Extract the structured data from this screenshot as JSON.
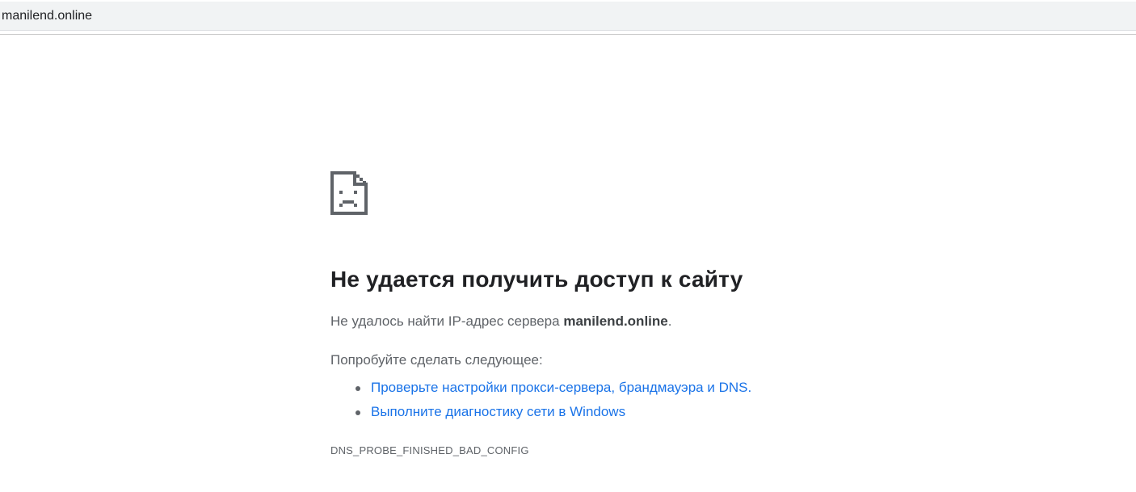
{
  "address_bar": {
    "url": "manilend.online"
  },
  "error": {
    "icon": "sad-page-icon",
    "title": "Не удается получить доступ к сайту",
    "subtitle_prefix": "Не удалось найти IP-адрес сервера ",
    "subtitle_host": "manilend.online",
    "subtitle_suffix": ".",
    "try_label": "Попробуйте сделать следующее:",
    "suggestions": [
      {
        "label": "Проверьте настройки прокси-сервера, брандмауэра и DNS."
      },
      {
        "label": "Выполните диагностику сети в Windows"
      }
    ],
    "code": "DNS_PROBE_FINISHED_BAD_CONFIG"
  },
  "colors": {
    "heading": "#202124",
    "body_text": "#5f6368",
    "link": "#1a73e8",
    "address_bar_bg": "#f1f3f4"
  }
}
